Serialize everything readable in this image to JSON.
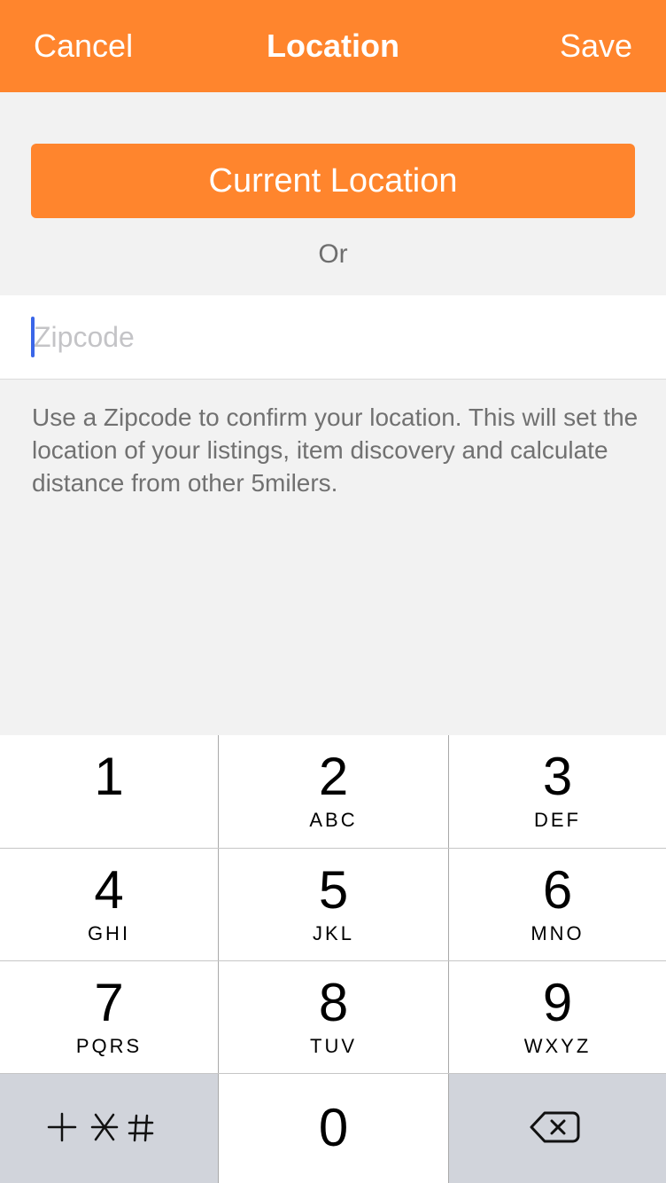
{
  "navbar": {
    "cancel_label": "Cancel",
    "title": "Location",
    "save_label": "Save",
    "color": "#ff852d"
  },
  "current_location": {
    "label": "Current Location"
  },
  "separator": {
    "label": "Or"
  },
  "zipcode": {
    "value": "",
    "placeholder": "Zipcode"
  },
  "help_text": "Use a Zipcode to confirm your location. This will set the location of your listings, item discovery and calculate distance from other 5milers.",
  "keypad": {
    "keys": [
      {
        "digit": "1",
        "letters": ""
      },
      {
        "digit": "2",
        "letters": "ABC"
      },
      {
        "digit": "3",
        "letters": "DEF"
      },
      {
        "digit": "4",
        "letters": "GHI"
      },
      {
        "digit": "5",
        "letters": "JKL"
      },
      {
        "digit": "6",
        "letters": "MNO"
      },
      {
        "digit": "7",
        "letters": "PQRS"
      },
      {
        "digit": "8",
        "letters": "TUV"
      },
      {
        "digit": "9",
        "letters": "WXYZ"
      },
      {
        "digit": "0",
        "letters": ""
      }
    ],
    "symbols_key_icon": "plus-asterisk-hash-icon",
    "delete_key_icon": "backspace-icon"
  }
}
